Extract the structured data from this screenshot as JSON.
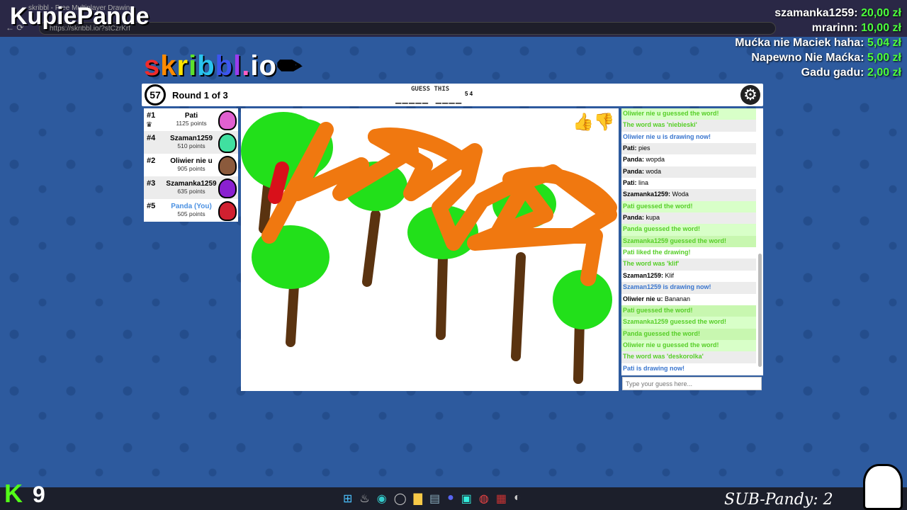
{
  "browser": {
    "tab_title": "skribbl - Free Multiplayer Drawin...",
    "url": "https://skribbl.io/?stCzrKrf"
  },
  "overlay": {
    "channel": "KupiePande",
    "kick_count": "9",
    "subs": "SUB-Pandy: 2",
    "donations": [
      {
        "name": "szamanka1259:",
        "amount": "20,00 zł"
      },
      {
        "name": "mrarinn:",
        "amount": "10,00 zł"
      },
      {
        "name": "Mućka nie Maciek haha:",
        "amount": "5,04 zł"
      },
      {
        "name": "Napewno Nie Maćka:",
        "amount": "5,00 zł"
      },
      {
        "name": "Gadu gadu:",
        "amount": "2,00 zł"
      }
    ]
  },
  "game": {
    "logo": "skribbl.io",
    "timer": "57",
    "round": "Round 1 of 3",
    "guess_label": "GUESS THIS",
    "word_hint": "_____ ____",
    "word_lengths": "5 4"
  },
  "players": [
    {
      "rank": "#1",
      "name": "Pati",
      "points": "1125 points",
      "color": "#e060d0"
    },
    {
      "rank": "#4",
      "name": "Szaman1259",
      "points": "510 points",
      "color": "#40e0a0"
    },
    {
      "rank": "#2",
      "name": "Oliwier nie u",
      "points": "905 points",
      "color": "#8b5a3c"
    },
    {
      "rank": "#3",
      "name": "Szamanka1259",
      "points": "635 points",
      "color": "#8a20d0"
    },
    {
      "rank": "#5",
      "name": "Panda (You)",
      "points": "505 points",
      "color": "#d02030"
    }
  ],
  "chat": {
    "placeholder": "Type your guess here...",
    "messages": [
      {
        "type": "guess",
        "text": "Oliwier nie u guessed the word!"
      },
      {
        "type": "green",
        "text": "The word was 'niebieski'"
      },
      {
        "type": "blue",
        "text": "Oliwier nie u is drawing now!"
      },
      {
        "type": "chat",
        "user": "Pati:",
        "text": " pies"
      },
      {
        "type": "chat",
        "user": "Panda:",
        "text": " wopda"
      },
      {
        "type": "chat",
        "user": "Panda:",
        "text": " woda"
      },
      {
        "type": "chat",
        "user": "Pati:",
        "text": " lina"
      },
      {
        "type": "chat",
        "user": "Szamanka1259:",
        "text": " Woda"
      },
      {
        "type": "guess",
        "text": "Pati guessed the word!"
      },
      {
        "type": "chat",
        "user": "Panda:",
        "text": " kupa"
      },
      {
        "type": "guess",
        "text": "Panda guessed the word!"
      },
      {
        "type": "guess",
        "text": "Szamanka1259 guessed the word!"
      },
      {
        "type": "green",
        "text": "Pati liked the drawing!"
      },
      {
        "type": "green",
        "text": "The word was 'klif'"
      },
      {
        "type": "chat",
        "user": "Szaman1259:",
        "text": " Klif"
      },
      {
        "type": "blue",
        "text": "Szaman1259 is drawing now!"
      },
      {
        "type": "chat",
        "user": "Oliwier nie u:",
        "text": " Bananan"
      },
      {
        "type": "guess",
        "text": "Pati guessed the word!"
      },
      {
        "type": "guess",
        "text": "Szamanka1259 guessed the word!"
      },
      {
        "type": "guess",
        "text": "Panda guessed the word!"
      },
      {
        "type": "guess",
        "text": "Oliwier nie u guessed the word!"
      },
      {
        "type": "green",
        "text": "The word was 'deskorolka'"
      },
      {
        "type": "blue",
        "text": "Pati is drawing now!"
      }
    ]
  }
}
